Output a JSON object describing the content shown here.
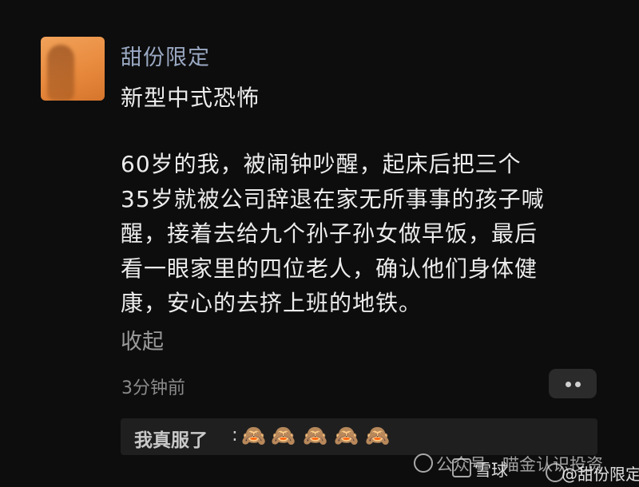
{
  "post": {
    "username": "甜份限定",
    "title": "新型中式恐怖",
    "body_lines": [
      "60岁的我，被闹钟吵醒，起床后把三个",
      "35岁就被公司辞退在家无所事事的孩子喊",
      "醒，接着去给九个孙子孙女做早饭，最后",
      "看一眼家里的四位老人，确认他们身体健",
      "康，安心的去挤上班的地铁。"
    ],
    "collapse_label": "收起",
    "timestamp": "3分钟前"
  },
  "comment": {
    "user": "我真服了",
    "separator": ":",
    "emoji": "🙈",
    "emoji_count": 5
  },
  "watermarks": {
    "wechat": "公众号 · 喵金认识投资",
    "xueqiu": "雪球",
    "weibo": "@甜份限定"
  },
  "icons": {
    "more": "more-dots-icon",
    "wechat": "wechat-icon",
    "xueqiu": "xueqiu-logo-icon",
    "weibo": "weibo-icon"
  }
}
